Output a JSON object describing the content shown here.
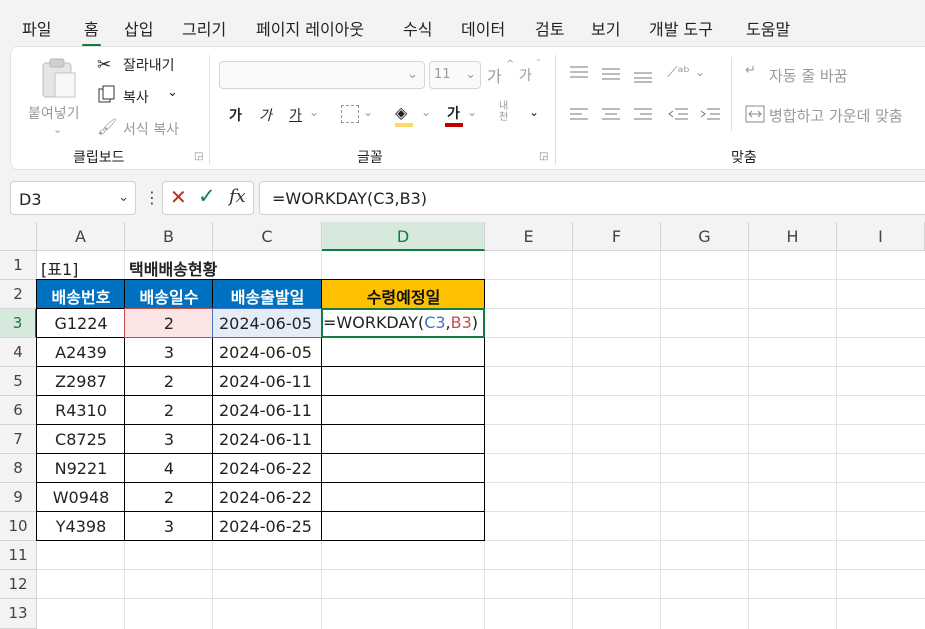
{
  "menu": {
    "items": [
      "파일",
      "홈",
      "삽입",
      "그리기",
      "페이지 레이아웃",
      "수식",
      "데이터",
      "검토",
      "보기",
      "개발 도구",
      "도움말"
    ]
  },
  "ribbon": {
    "paste": "붙여넣기",
    "cut": "잘라내기",
    "copy": "복사",
    "format_painter": "서식 복사",
    "clipboard_label": "클립보드",
    "font_size": "11",
    "font_label": "글꼴",
    "align_label": "맞춤",
    "wrap_text": "자동 줄 바꿈",
    "merge_center": "병합하고 가운데 맞춤",
    "grow_font": "가",
    "shrink_font": "가",
    "bold": "가",
    "italic": "가",
    "underline": "가",
    "font_color": "가",
    "phonetic": "내천"
  },
  "formula_bar": {
    "name_box": "D3",
    "formula": "=WORKDAY(C3,B3)"
  },
  "sheet": {
    "columns": [
      "A",
      "B",
      "C",
      "D",
      "E",
      "F",
      "G",
      "H",
      "I"
    ],
    "rows": [
      "1",
      "2",
      "3",
      "4",
      "5",
      "6",
      "7",
      "8",
      "9",
      "10",
      "11",
      "12",
      "13"
    ],
    "a1": "[표1]",
    "b1": "택배배송현황",
    "headers": [
      "배송번호",
      "배송일수",
      "배송출발일",
      "수령예정일"
    ],
    "data": [
      [
        "G1224",
        "2",
        "2024-06-05"
      ],
      [
        "A2439",
        "3",
        "2024-06-05"
      ],
      [
        "Z2987",
        "2",
        "2024-06-11"
      ],
      [
        "R4310",
        "2",
        "2024-06-11"
      ],
      [
        "C8725",
        "3",
        "2024-06-11"
      ],
      [
        "N9221",
        "4",
        "2024-06-22"
      ],
      [
        "W0948",
        "2",
        "2024-06-22"
      ],
      [
        "Y4398",
        "3",
        "2024-06-25"
      ]
    ],
    "edit_formula": {
      "prefix": "=WORKDAY(",
      "ref1": "C3",
      "sep": ",",
      "ref2": "B3",
      "suffix": ")"
    }
  },
  "colors": {
    "accent": "#107c41",
    "header_blue": "#0070c0",
    "header_gold": "#ffc000",
    "ref_blue": "#4472c4",
    "ref_red": "#c0504d"
  }
}
